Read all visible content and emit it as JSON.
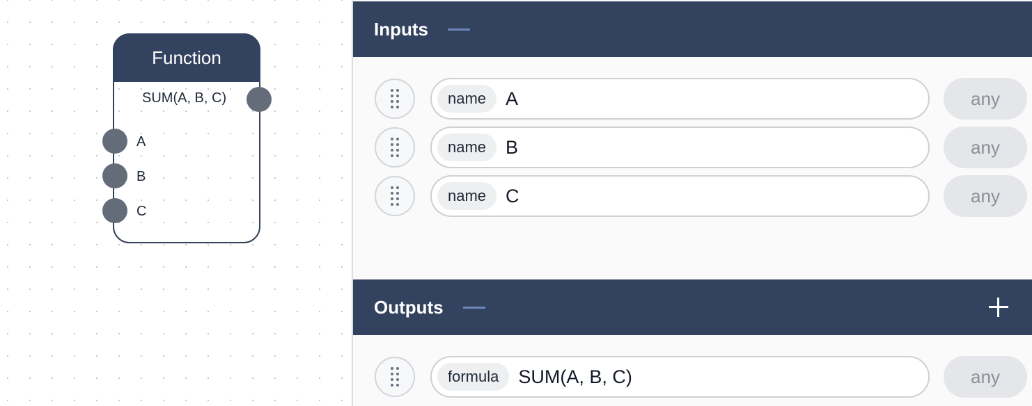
{
  "node": {
    "title": "Function",
    "output_label": "SUM(A, B, C)",
    "inputs": [
      "A",
      "B",
      "C"
    ]
  },
  "inputs_section": {
    "title": "Inputs",
    "rows": [
      {
        "tag": "name",
        "value": "A",
        "type": "any"
      },
      {
        "tag": "name",
        "value": "B",
        "type": "any"
      },
      {
        "tag": "name",
        "value": "C",
        "type": "any"
      }
    ]
  },
  "outputs_section": {
    "title": "Outputs",
    "rows": [
      {
        "tag": "formula",
        "value": "SUM(A, B, C)",
        "type": "any"
      }
    ]
  },
  "icons": {
    "collapse": "minus-icon",
    "add": "plus-icon",
    "drag": "drag-handle-icon"
  },
  "colors": {
    "header_bg": "#33425e",
    "accent": "#6b88b8",
    "port": "#646c7a"
  }
}
